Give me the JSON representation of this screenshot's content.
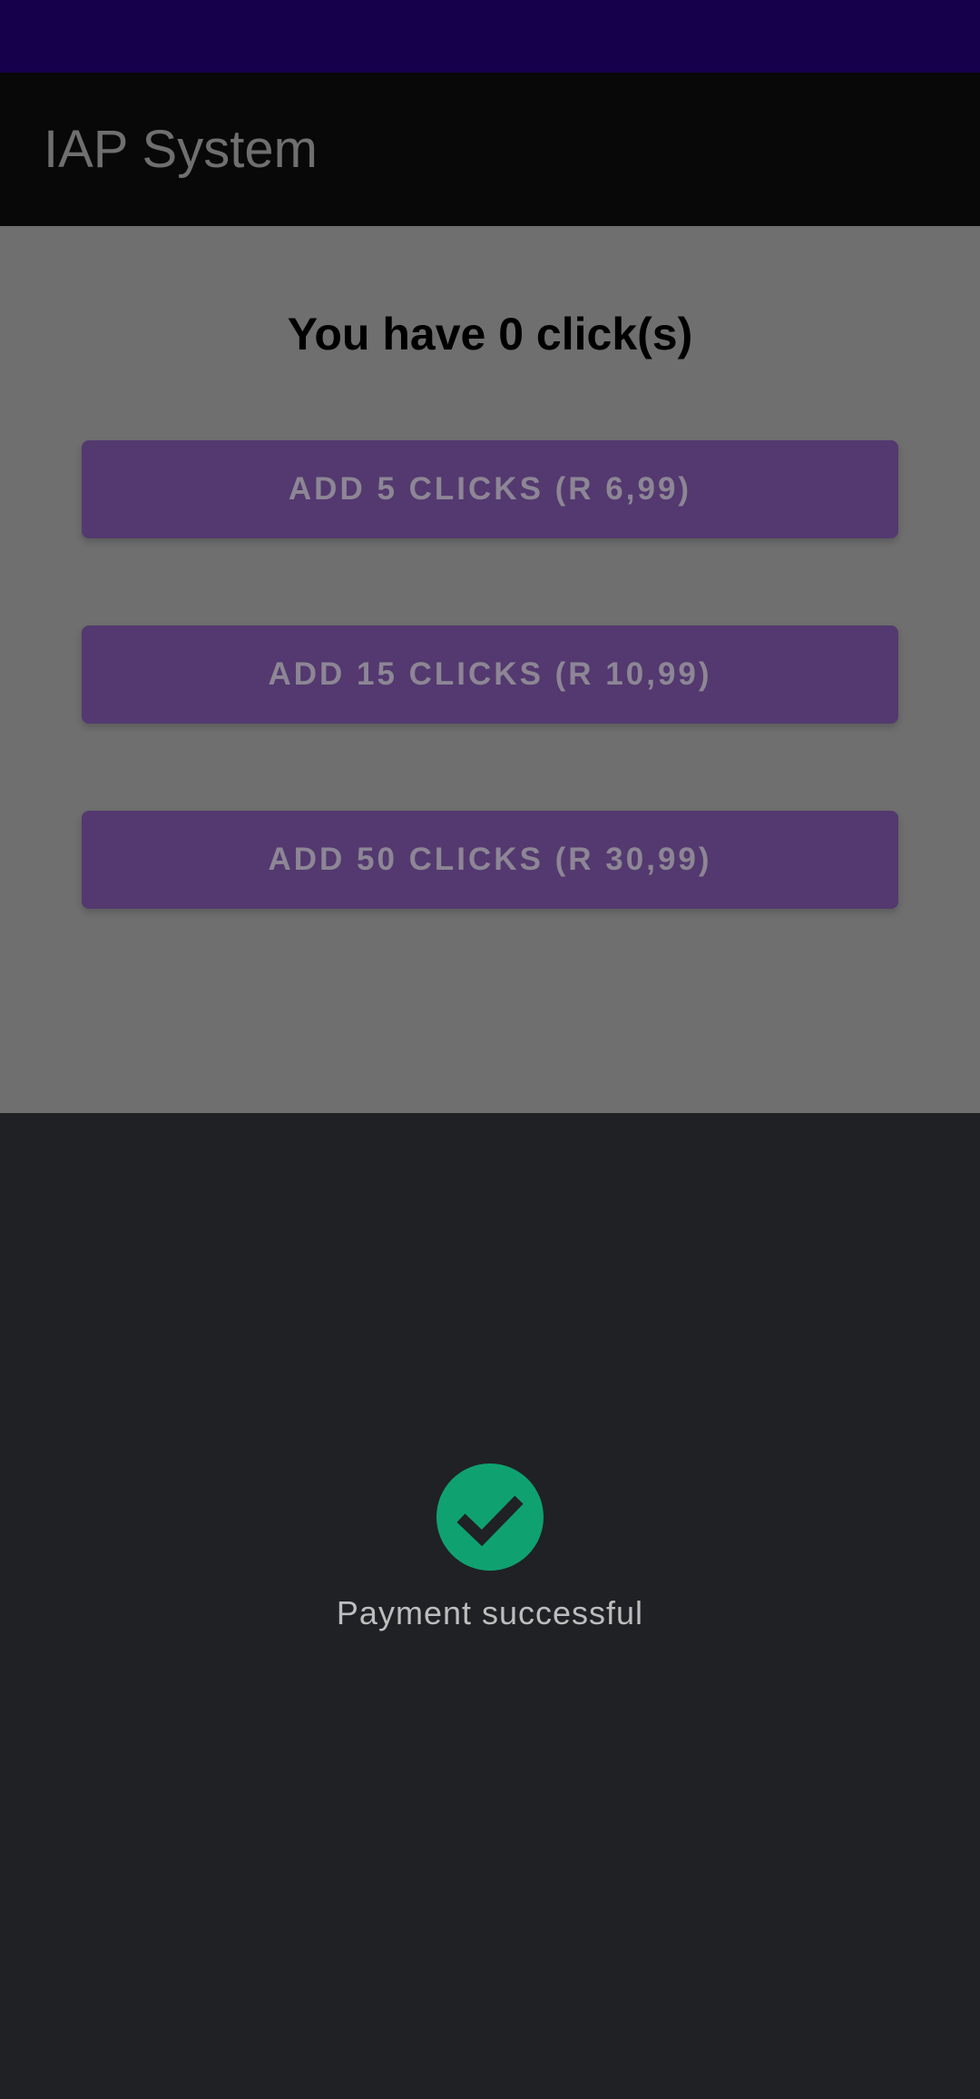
{
  "app": {
    "title": "IAP System"
  },
  "main": {
    "click_count_text": "You have 0 click(s)",
    "buttons": [
      {
        "label": "ADD 5 CLICKS (R 6,99)"
      },
      {
        "label": "ADD 15 CLICKS (R 10,99)"
      },
      {
        "label": "ADD 50 CLICKS (R 30,99)"
      }
    ]
  },
  "payment_sheet": {
    "icon": "check-circle-icon",
    "message": "Payment successful"
  },
  "colors": {
    "status_bar": "#17004b",
    "app_bar": "#080808",
    "content_overlay": "#6f6f6f",
    "button": "#53396f",
    "sheet": "#202124",
    "success": "#0fa270"
  }
}
